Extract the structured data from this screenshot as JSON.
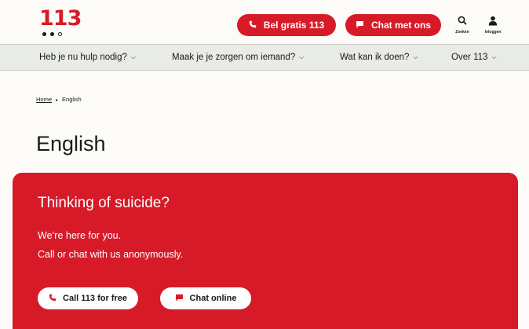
{
  "header": {
    "logo_text": "113",
    "call_button": "Bel gratis 113",
    "chat_button": "Chat met ons",
    "search_label": "Zoeken",
    "login_label": "Inloggen"
  },
  "nav": {
    "items": [
      {
        "label": "Heb je nu hulp nodig?"
      },
      {
        "label": "Maak je je zorgen om iemand?"
      },
      {
        "label": "Wat kan ik doen?"
      },
      {
        "label": "Over 113"
      }
    ]
  },
  "breadcrumb": {
    "home": "Home",
    "current": "English"
  },
  "page": {
    "title": "English"
  },
  "hero": {
    "heading": "Thinking of suicide?",
    "line1": "We’re here for you.",
    "line2": "Call or chat with us anonymously.",
    "call_button": "Call 113 for free",
    "chat_button": "Chat online"
  },
  "colors": {
    "brand_red": "#d71a28",
    "background": "#fcfbf7",
    "nav_background": "#e8ebe6",
    "text": "#1a1a1a"
  },
  "icons": [
    "phone-icon",
    "chat-bubble-icon",
    "search-icon",
    "user-icon",
    "chevron-down-icon",
    "breadcrumb-arrow-icon"
  ]
}
